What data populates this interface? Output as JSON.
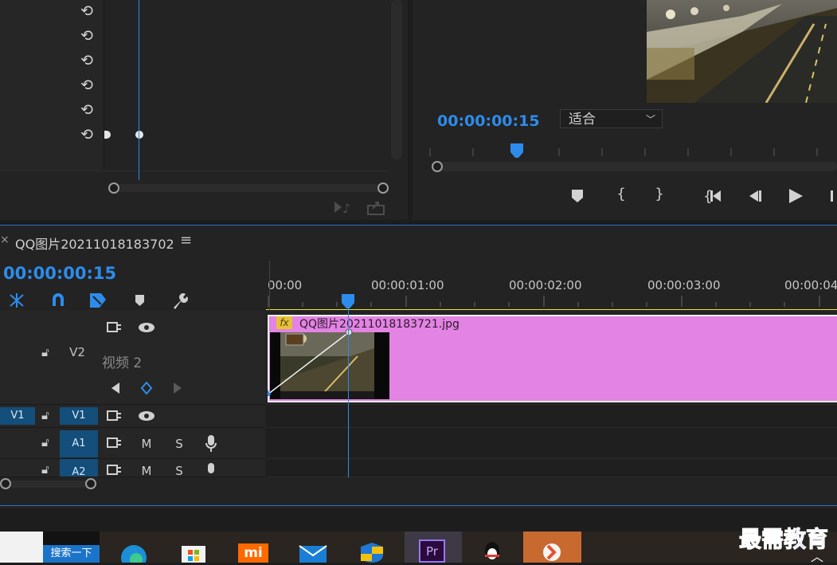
{
  "effect_controls": {
    "reset_glyph": "⟲",
    "reset_rows": 6
  },
  "program_monitor": {
    "timecode": "00:00:00:15",
    "fit_dropdown": "适合",
    "transport": [
      "add-marker",
      "mark-in",
      "mark-out",
      "go-to-in",
      "step-back",
      "play",
      "step-forward"
    ]
  },
  "sequence": {
    "close_glyph": "×",
    "title": "QQ图片20211018183702",
    "menu_glyph": "≡",
    "timecode": "00:00:00:15",
    "ruler": [
      "00:00",
      "00:00:01:00",
      "00:00:02:00",
      "00:00:03:00",
      "00:00:04:"
    ],
    "tracks": {
      "v2": {
        "name": "V2",
        "label": "视频 2"
      },
      "v1": {
        "src": "V1",
        "name": "V1"
      },
      "a1": {
        "name": "A1",
        "mute": "M",
        "solo": "S"
      },
      "a2": {
        "name": "A2",
        "mute": "M",
        "solo": "S"
      }
    },
    "clip": {
      "fx": "fx",
      "name": "QQ图片20211018183721.jpg",
      "color": "#e383e3"
    }
  },
  "taskbar": {
    "search_label": "搜索一下",
    "apps": [
      "edge-icon",
      "store-icon",
      "xiaomi-icon",
      "mail-icon",
      "security-icon",
      "premiere-icon",
      "qq-icon",
      "app-icon"
    ],
    "premiere_label": "Pr",
    "xiaomi_label": "mi"
  },
  "watermark": "最需教育",
  "colors": {
    "accent_blue": "#2d8ceb",
    "clip_pink": "#e383e3",
    "work_area_yellow": "#e8e62a"
  }
}
